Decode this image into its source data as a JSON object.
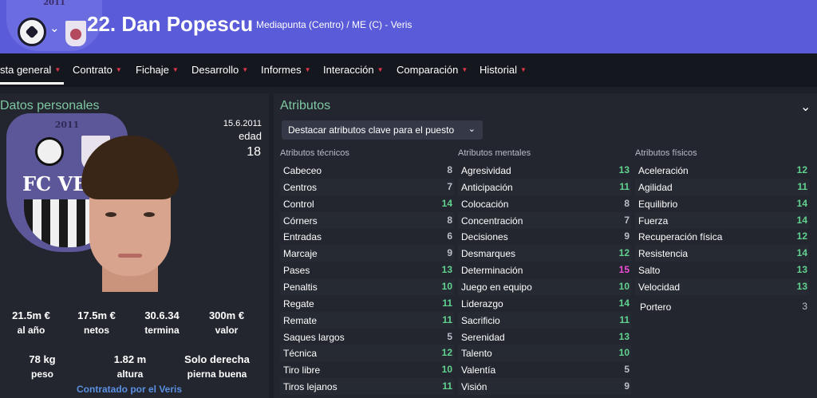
{
  "header": {
    "crest_year": "2011",
    "player_name": "22. Dan Popescu",
    "player_sub": "Mediapunta (Centro) / ME (C) - Veris",
    "colors": {
      "header_bg": "#5a5bd8",
      "accent": "#7ec8a2",
      "nav_arrow": "#e0374a"
    }
  },
  "nav": {
    "items": [
      {
        "label": "sta general"
      },
      {
        "label": "Contrato"
      },
      {
        "label": "Fichaje"
      },
      {
        "label": "Desarrollo"
      },
      {
        "label": "Informes"
      },
      {
        "label": "Interacción"
      },
      {
        "label": "Comparación"
      },
      {
        "label": "Historial"
      }
    ]
  },
  "personal": {
    "title": "Datos personales",
    "crest_year": "2011",
    "crest_text": "FC VE",
    "date": "15.6.2011",
    "age_label": "edad",
    "age_value": "18",
    "stats_row1": [
      {
        "value": "21.5m €",
        "label": "al año"
      },
      {
        "value": "17.5m €",
        "label": "netos"
      },
      {
        "value": "30.6.34",
        "label": "termina"
      },
      {
        "value": "300m €",
        "label": "valor"
      }
    ],
    "stats_row2": [
      {
        "value": "78 kg",
        "label": "peso"
      },
      {
        "value": "1.82 m",
        "label": "altura"
      },
      {
        "value": "Solo derecha",
        "label": "pierna buena"
      }
    ],
    "contracted": "Contratado por el Veris"
  },
  "attributes": {
    "title": "Atributos",
    "highlight_label": "Destacar atributos clave para el puesto",
    "technical": {
      "header": "Atributos técnicos",
      "items": [
        {
          "name": "Cabeceo",
          "value": "8",
          "color": "grey"
        },
        {
          "name": "Centros",
          "value": "7",
          "color": "grey"
        },
        {
          "name": "Control",
          "value": "14",
          "color": "green"
        },
        {
          "name": "Córners",
          "value": "8",
          "color": "grey"
        },
        {
          "name": "Entradas",
          "value": "6",
          "color": "grey"
        },
        {
          "name": "Marcaje",
          "value": "9",
          "color": "grey"
        },
        {
          "name": "Pases",
          "value": "13",
          "color": "green"
        },
        {
          "name": "Penaltis",
          "value": "10",
          "color": "green"
        },
        {
          "name": "Regate",
          "value": "11",
          "color": "green"
        },
        {
          "name": "Remate",
          "value": "11",
          "color": "green"
        },
        {
          "name": "Saques largos",
          "value": "5",
          "color": "grey"
        },
        {
          "name": "Técnica",
          "value": "12",
          "color": "green"
        },
        {
          "name": "Tiro libre",
          "value": "10",
          "color": "green"
        },
        {
          "name": "Tiros lejanos",
          "value": "11",
          "color": "green"
        }
      ]
    },
    "mental": {
      "header": "Atributos mentales",
      "items": [
        {
          "name": "Agresividad",
          "value": "13",
          "color": "green"
        },
        {
          "name": "Anticipación",
          "value": "11",
          "color": "green"
        },
        {
          "name": "Colocación",
          "value": "8",
          "color": "grey"
        },
        {
          "name": "Concentración",
          "value": "7",
          "color": "grey"
        },
        {
          "name": "Decisiones",
          "value": "9",
          "color": "grey"
        },
        {
          "name": "Desmarques",
          "value": "12",
          "color": "green"
        },
        {
          "name": "Determinación",
          "value": "15",
          "color": "pink"
        },
        {
          "name": "Juego en equipo",
          "value": "10",
          "color": "green"
        },
        {
          "name": "Liderazgo",
          "value": "14",
          "color": "green"
        },
        {
          "name": "Sacrificio",
          "value": "11",
          "color": "green"
        },
        {
          "name": "Serenidad",
          "value": "13",
          "color": "green"
        },
        {
          "name": "Talento",
          "value": "10",
          "color": "green"
        },
        {
          "name": "Valentía",
          "value": "5",
          "color": "grey"
        },
        {
          "name": "Visión",
          "value": "9",
          "color": "grey"
        }
      ]
    },
    "physical": {
      "header": "Atributos físicos",
      "items": [
        {
          "name": "Aceleración",
          "value": "12",
          "color": "green"
        },
        {
          "name": "Agilidad",
          "value": "11",
          "color": "green"
        },
        {
          "name": "Equilibrio",
          "value": "14",
          "color": "green"
        },
        {
          "name": "Fuerza",
          "value": "14",
          "color": "green"
        },
        {
          "name": "Recuperación física",
          "value": "12",
          "color": "green"
        },
        {
          "name": "Resistencia",
          "value": "14",
          "color": "green"
        },
        {
          "name": "Salto",
          "value": "13",
          "color": "green"
        },
        {
          "name": "Velocidad",
          "value": "13",
          "color": "green"
        }
      ],
      "goalkeeper": {
        "name": "Portero",
        "value": "3",
        "color": "grey"
      }
    }
  }
}
